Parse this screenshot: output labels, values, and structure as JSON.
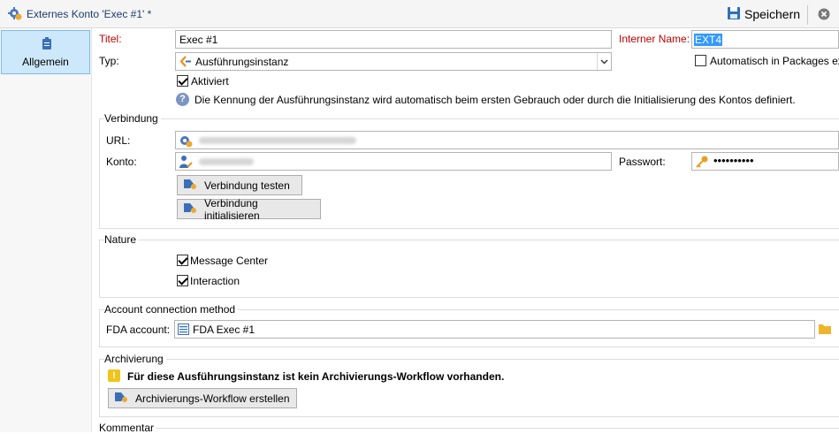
{
  "window": {
    "title": "Externes Konto 'Exec #1' *",
    "icon": "gear-account-icon"
  },
  "toolbar": {
    "save_label": "Speichern",
    "save_icon": "floppy-disk-icon",
    "close_icon": "close-circle-icon"
  },
  "sidebar": {
    "items": [
      {
        "label": "Allgemein",
        "icon": "clipboard-icon"
      }
    ]
  },
  "general": {
    "title_label": "Titel:",
    "title_value": "Exec #1",
    "internal_name_label": "Interner Name:",
    "internal_name_value": "EXT4",
    "type_label": "Typ:",
    "type_value": "Ausführungsinstanz",
    "auto_packages_label": "Automatisch in Packages ex",
    "active_label": "Aktiviert",
    "info_text": "Die Kennung der Ausführungsinstanz wird automatisch beim ersten Gebrauch oder durch die Initialisierung des Kontos definiert."
  },
  "connection": {
    "section_title": "Verbindung",
    "url_label": "URL:",
    "account_label": "Konto:",
    "password_label": "Passwort:",
    "password_mask": "••••••••••",
    "test_button": "Verbindung testen",
    "init_button": "Verbindung initialisieren"
  },
  "nature": {
    "section_title": "Nature",
    "message_center_label": "Message Center",
    "interaction_label": "Interaction"
  },
  "account_method": {
    "section_title": "Account connection method",
    "fda_label": "FDA account:",
    "fda_value": "FDA Exec #1"
  },
  "archiving": {
    "section_title": "Archivierung",
    "warning_text": "Für diese Ausführungsinstanz ist kein Archivierungs-Workflow vorhanden.",
    "create_button": "Archivierungs-Workflow erstellen"
  },
  "comment": {
    "section_title": "Kommentar"
  },
  "colors": {
    "accent": "#3399ff",
    "label_red": "#c00000",
    "title_blue": "#1c3c70",
    "sidebar_selected": "#cde8fb"
  }
}
